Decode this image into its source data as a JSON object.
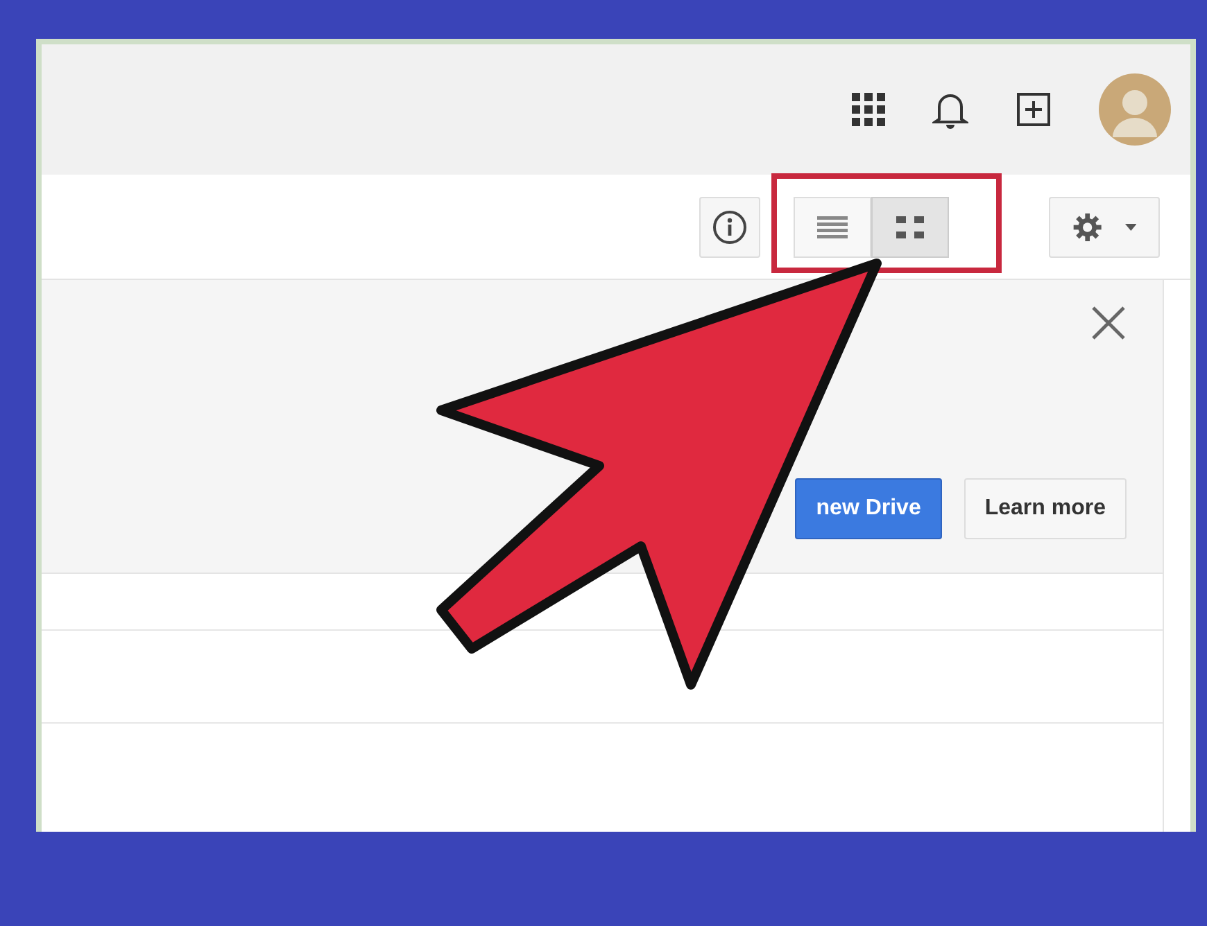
{
  "top_bar": {
    "icons": [
      {
        "kind": "apps"
      },
      {
        "kind": "bell"
      },
      {
        "kind": "add"
      },
      {
        "kind": "avatar"
      }
    ]
  },
  "toolbar": {
    "view_toggle": [
      {
        "kind": "list",
        "selected": false
      },
      {
        "kind": "grid",
        "selected": true
      }
    ]
  },
  "banner": {
    "buttons": [
      {
        "label": "new Drive",
        "kind": "primary"
      },
      {
        "label": "Learn more",
        "kind": "secondary"
      }
    ]
  }
}
